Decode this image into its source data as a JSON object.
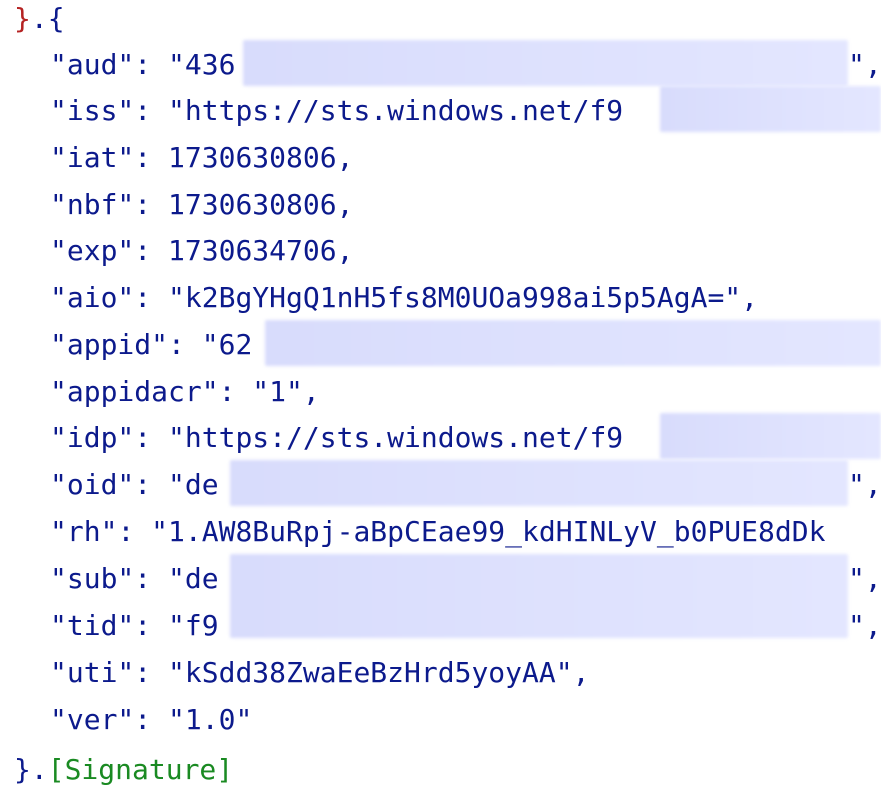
{
  "header": {
    "open_close_brace": "}",
    "open_suffix": ".{"
  },
  "claims": [
    {
      "key": "\"aud\"",
      "sep": ": ",
      "value": "\"436",
      "tail": "\","
    },
    {
      "key": "\"iss\"",
      "sep": ": ",
      "value": "\"https://sts.windows.net/f9",
      "tail": ""
    },
    {
      "key": "\"iat\"",
      "sep": ": ",
      "value": "1730630806,",
      "tail": ""
    },
    {
      "key": "\"nbf\"",
      "sep": ": ",
      "value": "1730630806,",
      "tail": ""
    },
    {
      "key": "\"exp\"",
      "sep": ": ",
      "value": "1730634706,",
      "tail": ""
    },
    {
      "key": "\"aio\"",
      "sep": ": ",
      "value": "\"k2BgYHgQ1nH5fs8M0UOa998ai5p5AgA=\",",
      "tail": ""
    },
    {
      "key": "\"appid\"",
      "sep": ": ",
      "value": "\"62",
      "tail": ""
    },
    {
      "key": "\"appidacr\"",
      "sep": ": ",
      "value": "\"1\",",
      "tail": ""
    },
    {
      "key": "\"idp\"",
      "sep": ": ",
      "value": "\"https://sts.windows.net/f9",
      "tail": ""
    },
    {
      "key": "\"oid\"",
      "sep": ": ",
      "value": "\"de",
      "tail": "\","
    },
    {
      "key": "\"rh\"",
      "sep": ": ",
      "value": "\"1.AW8BuRpj-aBpCEae99_kdHINLyV_b0PUE8dDk",
      "tail": ""
    },
    {
      "key": "\"sub\"",
      "sep": ": ",
      "value": "\"de",
      "tail": "\","
    },
    {
      "key": "\"tid\"",
      "sep": ": ",
      "value": "\"f9",
      "tail": "\","
    },
    {
      "key": "\"uti\"",
      "sep": ": ",
      "value": "\"kSdd38ZwaEeBzHrd5yoyAA\",",
      "tail": ""
    },
    {
      "key": "\"ver\"",
      "sep": ": ",
      "value": "\"1.0\"",
      "tail": ""
    }
  ],
  "footer": {
    "close_brace": "}",
    "dot": ".",
    "signature": "[Signature]"
  },
  "colors": {
    "text": "#0c1a8c",
    "brace": "#b52222",
    "signature": "#1a8a22",
    "redaction": "#dcdffc"
  }
}
